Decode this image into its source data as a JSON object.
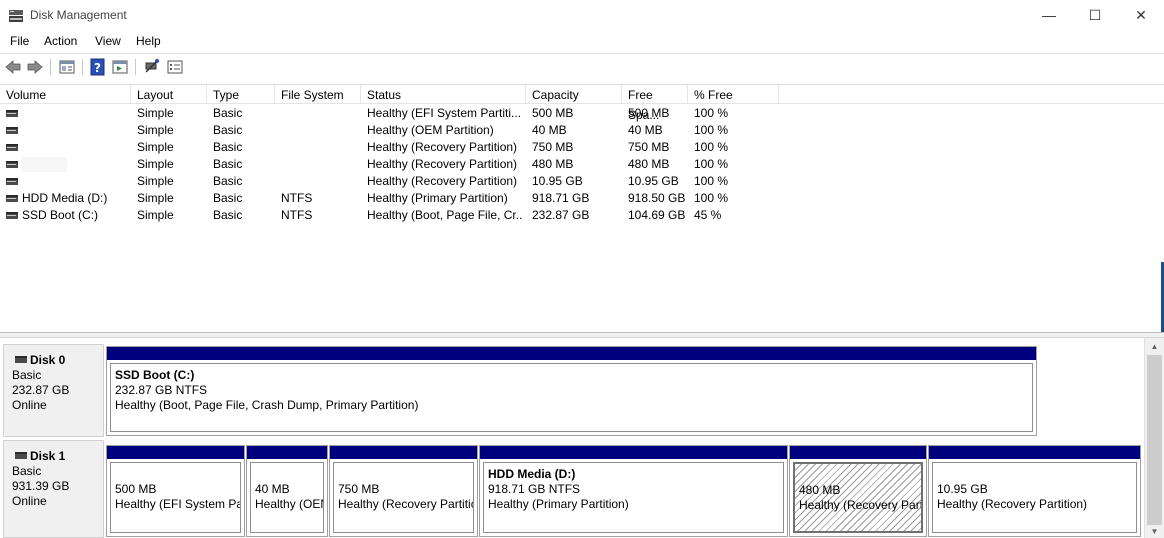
{
  "window": {
    "title": "Disk Management",
    "minimize_glyph": "—",
    "maximize_glyph": "☐",
    "close_glyph": "✕"
  },
  "menu": [
    "File",
    "Action",
    "View",
    "Help"
  ],
  "toolbar": {
    "icons": [
      "back-icon",
      "forward-icon",
      "properties-icon",
      "help-icon",
      "console-tree-icon",
      "connect-icon",
      "settings-icon"
    ]
  },
  "volume_list": {
    "columns": [
      "Volume",
      "Layout",
      "Type",
      "File System",
      "Status",
      "Capacity",
      "Free Spa...",
      "% Free"
    ],
    "rows": [
      {
        "volume": "",
        "layout": "Simple",
        "type": "Basic",
        "fs": "",
        "status": "Healthy (EFI System Partiti...",
        "capacity": "500 MB",
        "free": "500 MB",
        "pct": "100 %"
      },
      {
        "volume": "",
        "layout": "Simple",
        "type": "Basic",
        "fs": "",
        "status": "Healthy (OEM Partition)",
        "capacity": "40 MB",
        "free": "40 MB",
        "pct": "100 %"
      },
      {
        "volume": "",
        "layout": "Simple",
        "type": "Basic",
        "fs": "",
        "status": "Healthy (Recovery Partition)",
        "capacity": "750 MB",
        "free": "750 MB",
        "pct": "100 %"
      },
      {
        "volume": "",
        "layout": "Simple",
        "type": "Basic",
        "fs": "",
        "status": "Healthy (Recovery Partition)",
        "capacity": "480 MB",
        "free": "480 MB",
        "pct": "100 %"
      },
      {
        "volume": "",
        "layout": "Simple",
        "type": "Basic",
        "fs": "",
        "status": "Healthy (Recovery Partition)",
        "capacity": "10.95 GB",
        "free": "10.95 GB",
        "pct": "100 %"
      },
      {
        "volume": "HDD Media (D:)",
        "layout": "Simple",
        "type": "Basic",
        "fs": "NTFS",
        "status": "Healthy (Primary Partition)",
        "capacity": "918.71 GB",
        "free": "918.50 GB",
        "pct": "100 %"
      },
      {
        "volume": "SSD Boot (C:)",
        "layout": "Simple",
        "type": "Basic",
        "fs": "NTFS",
        "status": "Healthy (Boot, Page File, Cr...",
        "capacity": "232.87 GB",
        "free": "104.69 GB",
        "pct": "45 %"
      }
    ]
  },
  "disks": [
    {
      "name": "Disk 0",
      "type": "Basic",
      "size": "232.87 GB",
      "state": "Online",
      "partitions": [
        {
          "name": "SSD Boot  (C:)",
          "size": "232.87 GB NTFS",
          "status": "Healthy (Boot, Page File, Crash Dump, Primary Partition)"
        }
      ]
    },
    {
      "name": "Disk 1",
      "type": "Basic",
      "size": "931.39 GB",
      "state": "Online",
      "partitions": [
        {
          "name": "",
          "size": "500 MB",
          "status": "Healthy (EFI System Par"
        },
        {
          "name": "",
          "size": "40 MB",
          "status": "Healthy (OEN"
        },
        {
          "name": "",
          "size": "750 MB",
          "status": "Healthy (Recovery Partitic"
        },
        {
          "name": "HDD Media  (D:)",
          "size": "918.71 GB NTFS",
          "status": "Healthy (Primary Partition)"
        },
        {
          "name": "",
          "size": "480 MB",
          "status": "Healthy (Recovery Parti"
        },
        {
          "name": "",
          "size": "10.95 GB",
          "status": "Healthy (Recovery Partition)"
        }
      ]
    }
  ],
  "colors": {
    "partition_bar": "#00007f",
    "selected_edge": "#1b4f8a"
  }
}
